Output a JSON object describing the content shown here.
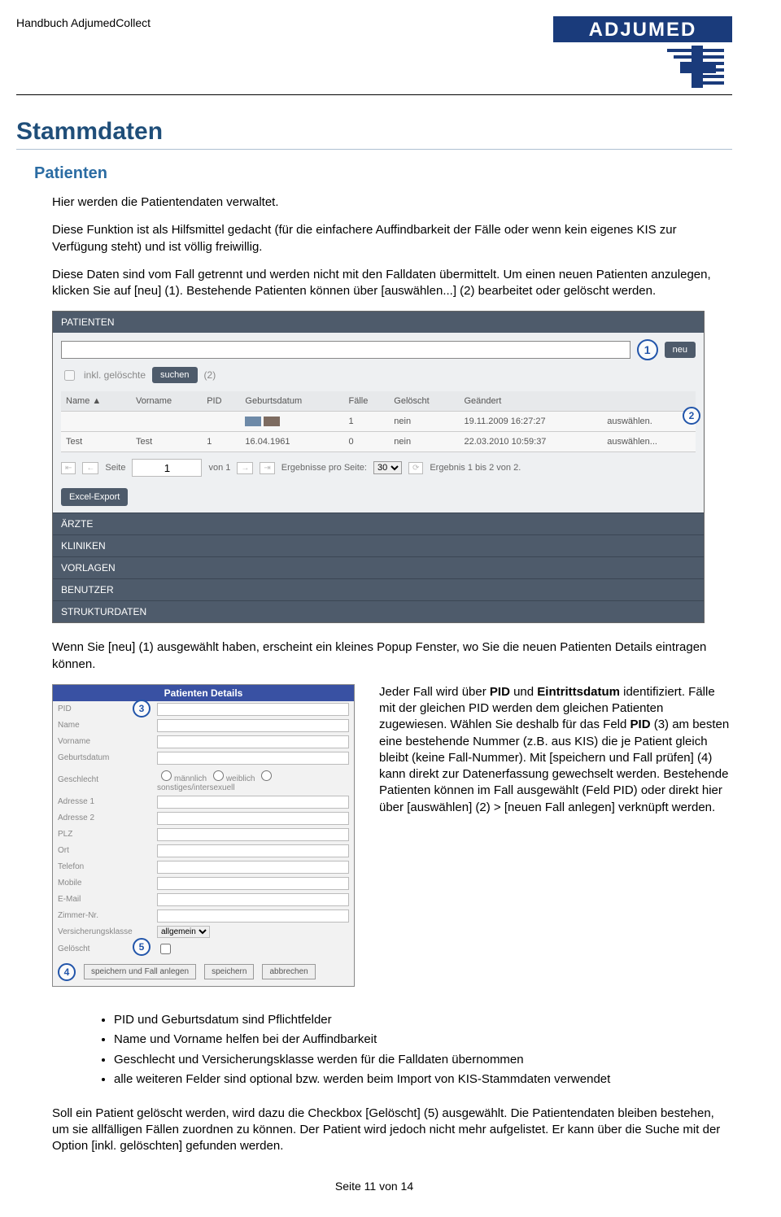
{
  "header": {
    "manual_title": "Handbuch AdjumedCollect",
    "logo_text_top": "ADJUMED"
  },
  "h1": "Stammdaten",
  "h2": "Patienten",
  "para1": "Hier werden die Patientendaten verwaltet.",
  "para2": "Diese Funktion ist als Hilfsmittel gedacht (für die einfachere Auffindbarkeit der Fälle oder wenn kein eigenes KIS zur Verfügung steht) und ist völlig freiwillig.",
  "para3": "Diese Daten sind vom Fall getrennt und werden nicht mit den Falldaten übermittelt. Um einen neuen Patienten anzulegen, klicken Sie auf [neu] (1). Bestehende Patienten können über [auswählen...] (2) bearbeitet oder gelöscht werden.",
  "ss1": {
    "bar_patienten": "PATIENTEN",
    "neu_btn": "neu",
    "incl_deleted": "inkl. gelöschte",
    "suchen_btn": "suchen",
    "marker2_after": "(2)",
    "headers": [
      "Name ▲",
      "Vorname",
      "PID",
      "Geburtsdatum",
      "Fälle",
      "Gelöscht",
      "Geändert",
      ""
    ],
    "rows": [
      {
        "name": "",
        "vorname": "",
        "pid": "",
        "geb": "",
        "faelle": "1",
        "gel": "nein",
        "geaendert": "19.11.2009 16:27:27",
        "aktion": "auswählen."
      },
      {
        "name": "Test",
        "vorname": "Test",
        "pid": "1",
        "geb": "16.04.1961",
        "faelle": "0",
        "gel": "nein",
        "geaendert": "22.03.2010 10:59:37",
        "aktion": "auswählen..."
      }
    ],
    "pager": {
      "seite_label": "Seite",
      "seite_value": "1",
      "von_label": "von 1",
      "ergebnisse_label": "Ergebnisse pro Seite:",
      "perpage_value": "30",
      "ergebnis_text": "Ergebnis 1 bis 2 von 2."
    },
    "excel_btn": "Excel-Export",
    "bars": [
      "ÄRZTE",
      "KLINIKEN",
      "VORLAGEN",
      "BENUTZER",
      "STRUKTURDATEN"
    ]
  },
  "para4": "Wenn Sie [neu] (1) ausgewählt haben, erscheint ein kleines Popup Fenster, wo Sie die neuen Patienten Details eintragen können.",
  "popup": {
    "title": "Patienten Details",
    "fields": [
      "PID",
      "Name",
      "Vorname",
      "Geburtsdatum",
      "Geschlecht",
      "Adresse 1",
      "Adresse 2",
      "PLZ",
      "Ort",
      "Telefon",
      "Mobile",
      "E-Mail",
      "Zimmer-Nr.",
      "Versicherungsklasse",
      "Gelöscht"
    ],
    "gender_opts": [
      "männlich",
      "weiblich",
      "sonstiges/intersexuell"
    ],
    "vers_value": "allgemein",
    "btns": [
      "speichern und Fall anlegen",
      "speichern",
      "abbrechen"
    ]
  },
  "side_para": "Jeder Fall wird über PID und Eintrittsdatum identifiziert. Fälle mit der gleichen PID werden dem gleichen Patienten zugewiesen. Wählen Sie deshalb für das Feld PID (3) am besten eine bestehende Nummer (z.B. aus KIS) die je Patient gleich bleibt (keine Fall-Nummer). Mit [speichern und Fall prüfen] (4) kann direkt zur Datenerfassung gewechselt werden. Bestehende Patienten können im Fall ausgewählt (Feld PID) oder direkt hier über [auswählen] (2) > [neuen Fall anlegen] verknüpft werden.",
  "side_bold": [
    "PID",
    "Eintrittsdatum",
    "PID"
  ],
  "bullets": [
    "PID und Geburtsdatum sind Pflichtfelder",
    "Name und Vorname helfen bei der Auffindbarkeit",
    "Geschlecht und Versicherungsklasse werden für die Falldaten übernommen",
    "alle weiteren Felder sind optional bzw. werden beim Import von KIS-Stammdaten verwendet"
  ],
  "para5": "Soll ein Patient gelöscht werden, wird dazu die Checkbox [Gelöscht] (5) ausgewählt. Die Patientendaten bleiben bestehen, um sie allfälligen Fällen zuordnen zu können. Der Patient wird jedoch nicht mehr aufgelistet. Er kann über die Suche mit der Option [inkl. gelöschten] gefunden werden.",
  "footer": "Seite 11 von 14"
}
